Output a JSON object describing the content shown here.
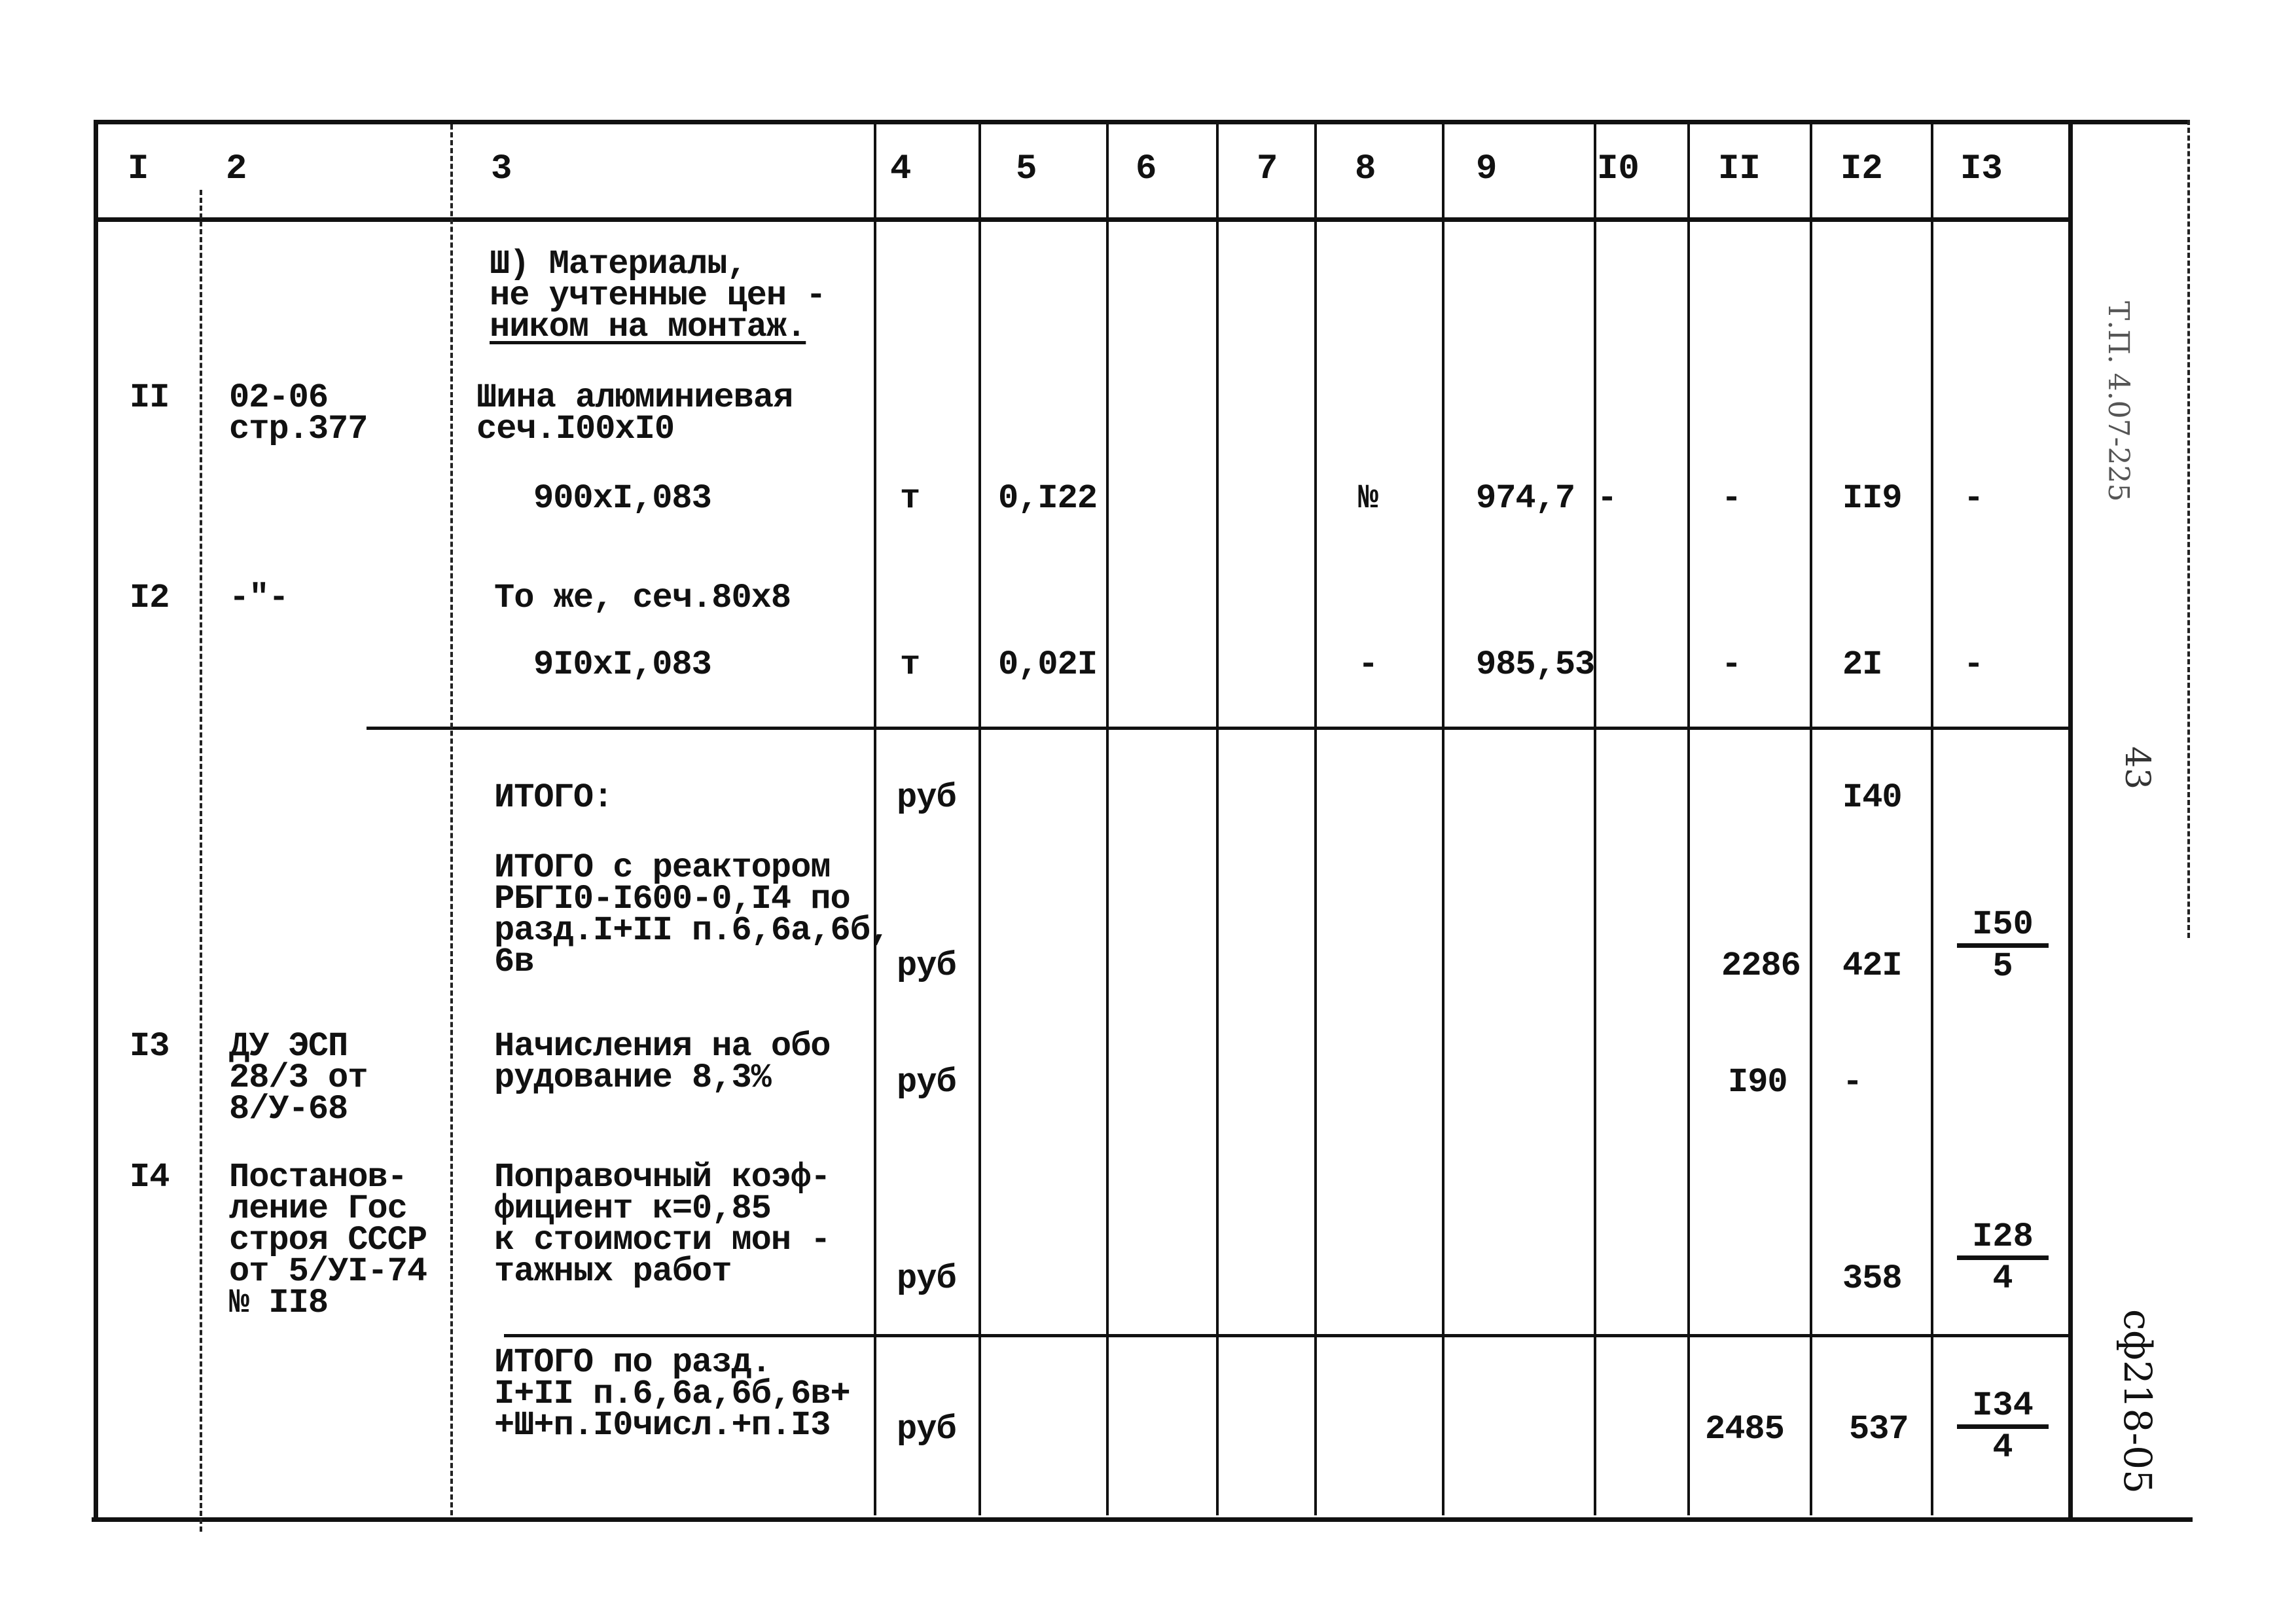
{
  "document": {
    "columns": [
      "I",
      "2",
      "3",
      "4",
      "5",
      "6",
      "7",
      "8",
      "9",
      "I0",
      "II",
      "I2",
      "I3"
    ],
    "rows": [
      {
        "num": "",
        "ref": "",
        "description": [
          "Ш) Материалы,",
          "не учтенные цен -",
          "ником на монтаж."
        ],
        "underlined_part": "ком на монтаж",
        "unit": "",
        "qty": "",
        "c8": "",
        "c9": "",
        "c10": "",
        "c11": "",
        "c12": "",
        "c13": ""
      },
      {
        "num": "II",
        "ref": [
          "02-06",
          "стр.377"
        ],
        "description": [
          "Шина алюминиевая",
          "сеч.I00xI0"
        ],
        "calc": "900xI,083",
        "unit": "т",
        "qty": "0,I22",
        "c8": "№",
        "c9": "974,7",
        "c10": "-",
        "c11": "-",
        "c12": "II9",
        "c13": "-"
      },
      {
        "num": "I2",
        "ref": [
          "-\"-"
        ],
        "description": [
          "То же, сеч.80x8"
        ],
        "calc": "9I0xI,083",
        "unit": "т",
        "qty": "0,02I",
        "c8": "-",
        "c9": "985,53",
        "c10": "",
        "c11": "-",
        "c12": "2I",
        "c13": "-"
      },
      {
        "num": "",
        "ref": [],
        "description": [
          "ИТОГО:"
        ],
        "unit": "руб",
        "c11": "",
        "c12": "I40",
        "c13": ""
      },
      {
        "num": "",
        "ref": [],
        "description": [
          "ИТОГО с реактором",
          "РБГI0-I600-0,I4 по",
          "разд.I+II п.6,6а,6б,",
          "6в"
        ],
        "unit": "руб",
        "c11": "2286",
        "c12": "42I",
        "c13": {
          "numerator": "I50",
          "denominator": "5"
        }
      },
      {
        "num": "I3",
        "ref": [
          "ДУ ЭСП",
          "28/3 от",
          "8/У-68"
        ],
        "description": [
          "Начисления на обо",
          "рудование 8,3%"
        ],
        "unit": "руб",
        "c11": "I90",
        "c12": "-",
        "c13": ""
      },
      {
        "num": "I4",
        "ref": [
          "Постанов-",
          "ление Гос",
          "строя СССР",
          "от 5/УI-74",
          "№ II8"
        ],
        "description": [
          "Поправочный коэф-",
          "фициент к=0,85",
          "к стоимости мон -",
          "тажных работ"
        ],
        "unit": "руб",
        "c11": "",
        "c12": "358",
        "c13": {
          "numerator": "I28",
          "denominator": "4"
        }
      },
      {
        "num": "",
        "ref": [],
        "description": [
          "ИТОГО по разд.",
          "I+II п.6,6а,6б,6в+",
          "+Ш+п.I0числ.+п.I3"
        ],
        "unit": "руб",
        "c11": "2485",
        "c12": "537",
        "c13": {
          "numerator": "I34",
          "denominator": "4"
        }
      }
    ]
  },
  "margin": {
    "stamp_top": "Т.П. 4.07-225",
    "page_number": "43",
    "stamp_bottom": "сф218-05"
  }
}
